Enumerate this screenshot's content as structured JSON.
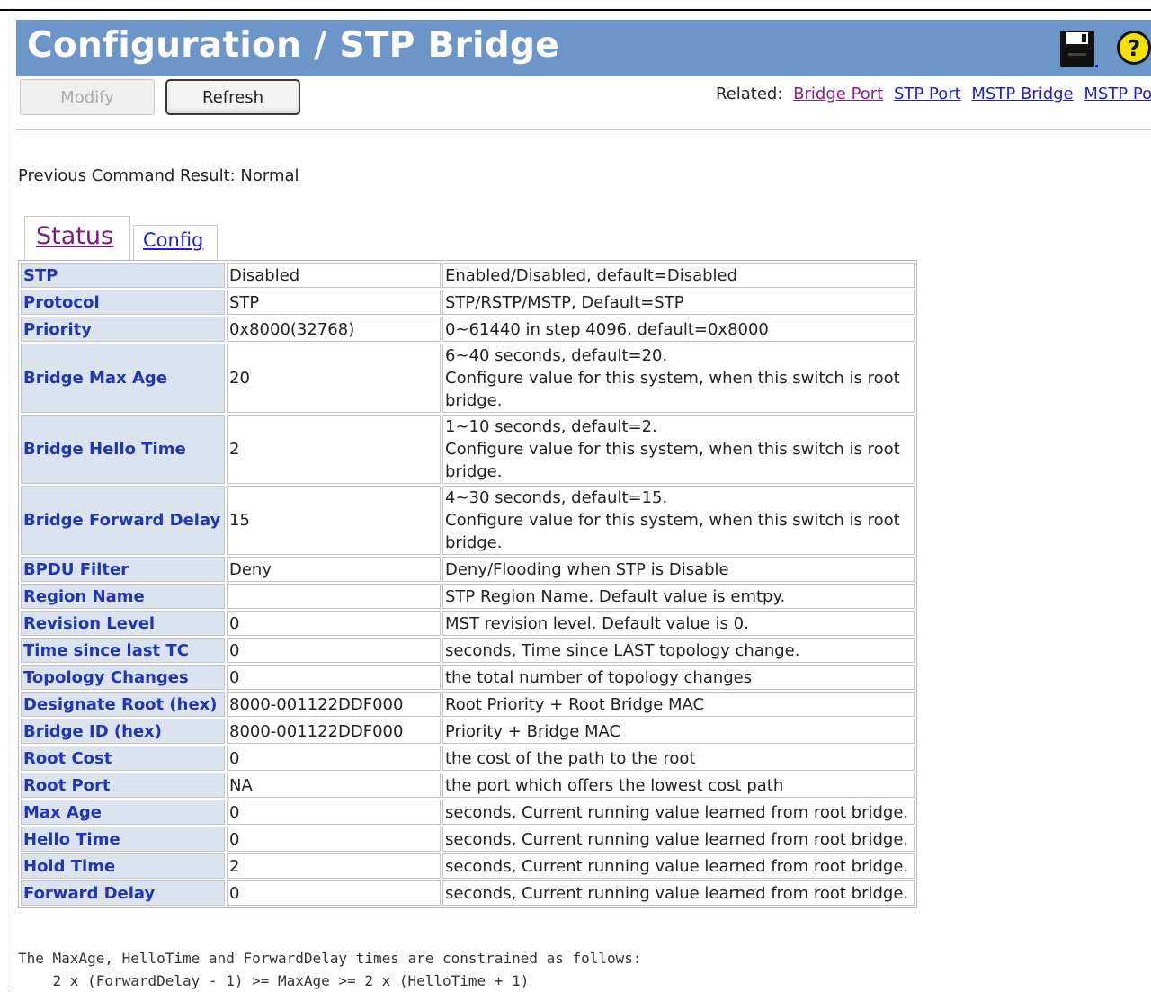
{
  "header": {
    "title": "Configuration / STP Bridge",
    "icons": [
      "save-icon",
      "help-icon"
    ]
  },
  "toolbar": {
    "modify_label": "Modify",
    "refresh_label": "Refresh"
  },
  "related": {
    "label": "Related:",
    "links": [
      "Bridge Port",
      "STP Port",
      "MSTP Bridge",
      "MSTP Port"
    ]
  },
  "previous_result": "Previous Command Result: Normal",
  "tabs": [
    {
      "label": "Status",
      "active": true
    },
    {
      "label": "Config",
      "active": false
    }
  ],
  "rows": [
    {
      "label": "STP",
      "value": "Disabled",
      "desc": "Enabled/Disabled, default=Disabled"
    },
    {
      "label": "Protocol",
      "value": "STP",
      "desc": "STP/RSTP/MSTP, Default=STP"
    },
    {
      "label": "Priority",
      "value": "0x8000(32768)",
      "desc": "0~61440 in step 4096, default=0x8000"
    },
    {
      "label": "Bridge Max Age",
      "value": "20",
      "desc": "6~40 seconds, default=20.\nConfigure value for this system, when this switch is root bridge."
    },
    {
      "label": "Bridge Hello Time",
      "value": "2",
      "desc": "1~10 seconds, default=2.\nConfigure value for this system, when this switch is root bridge."
    },
    {
      "label": "Bridge Forward Delay",
      "value": "15",
      "desc": "4~30 seconds, default=15.\nConfigure value for this system, when this switch is root bridge."
    },
    {
      "label": "BPDU Filter",
      "value": "Deny",
      "desc": "Deny/Flooding when STP is Disable"
    },
    {
      "label": "Region Name",
      "value": "",
      "desc": "STP Region Name. Default value is emtpy."
    },
    {
      "label": "Revision Level",
      "value": "0",
      "desc": "MST revision level. Default value is 0."
    },
    {
      "label": "Time since last TC",
      "value": "0",
      "desc": "seconds, Time since LAST topology change."
    },
    {
      "label": "Topology Changes",
      "value": "0",
      "desc": "the total number of topology changes"
    },
    {
      "label": "Designate Root (hex)",
      "value": "8000-001122DDF000",
      "desc": "Root Priority + Root Bridge MAC"
    },
    {
      "label": "Bridge ID (hex)",
      "value": "8000-001122DDF000",
      "desc": "Priority + Bridge MAC"
    },
    {
      "label": "Root Cost",
      "value": "0",
      "desc": "the cost of the path to the root"
    },
    {
      "label": "Root Port",
      "value": "NA",
      "desc": "the port which offers the lowest cost path"
    },
    {
      "label": "Max Age",
      "value": "0",
      "desc": "seconds, Current running value learned from root bridge."
    },
    {
      "label": "Hello Time",
      "value": "0",
      "desc": "seconds, Current running value learned from root bridge."
    },
    {
      "label": "Hold Time",
      "value": "2",
      "desc": "seconds, Current running value learned from root bridge."
    },
    {
      "label": "Forward Delay",
      "value": "0",
      "desc": "seconds, Current running value learned from root bridge."
    }
  ],
  "note": {
    "line1": "The MaxAge, HelloTime and ForwardDelay times are constrained as follows:",
    "line2": "    2 x (ForwardDelay - 1) >= MaxAge >= 2 x (HelloTime + 1)"
  }
}
